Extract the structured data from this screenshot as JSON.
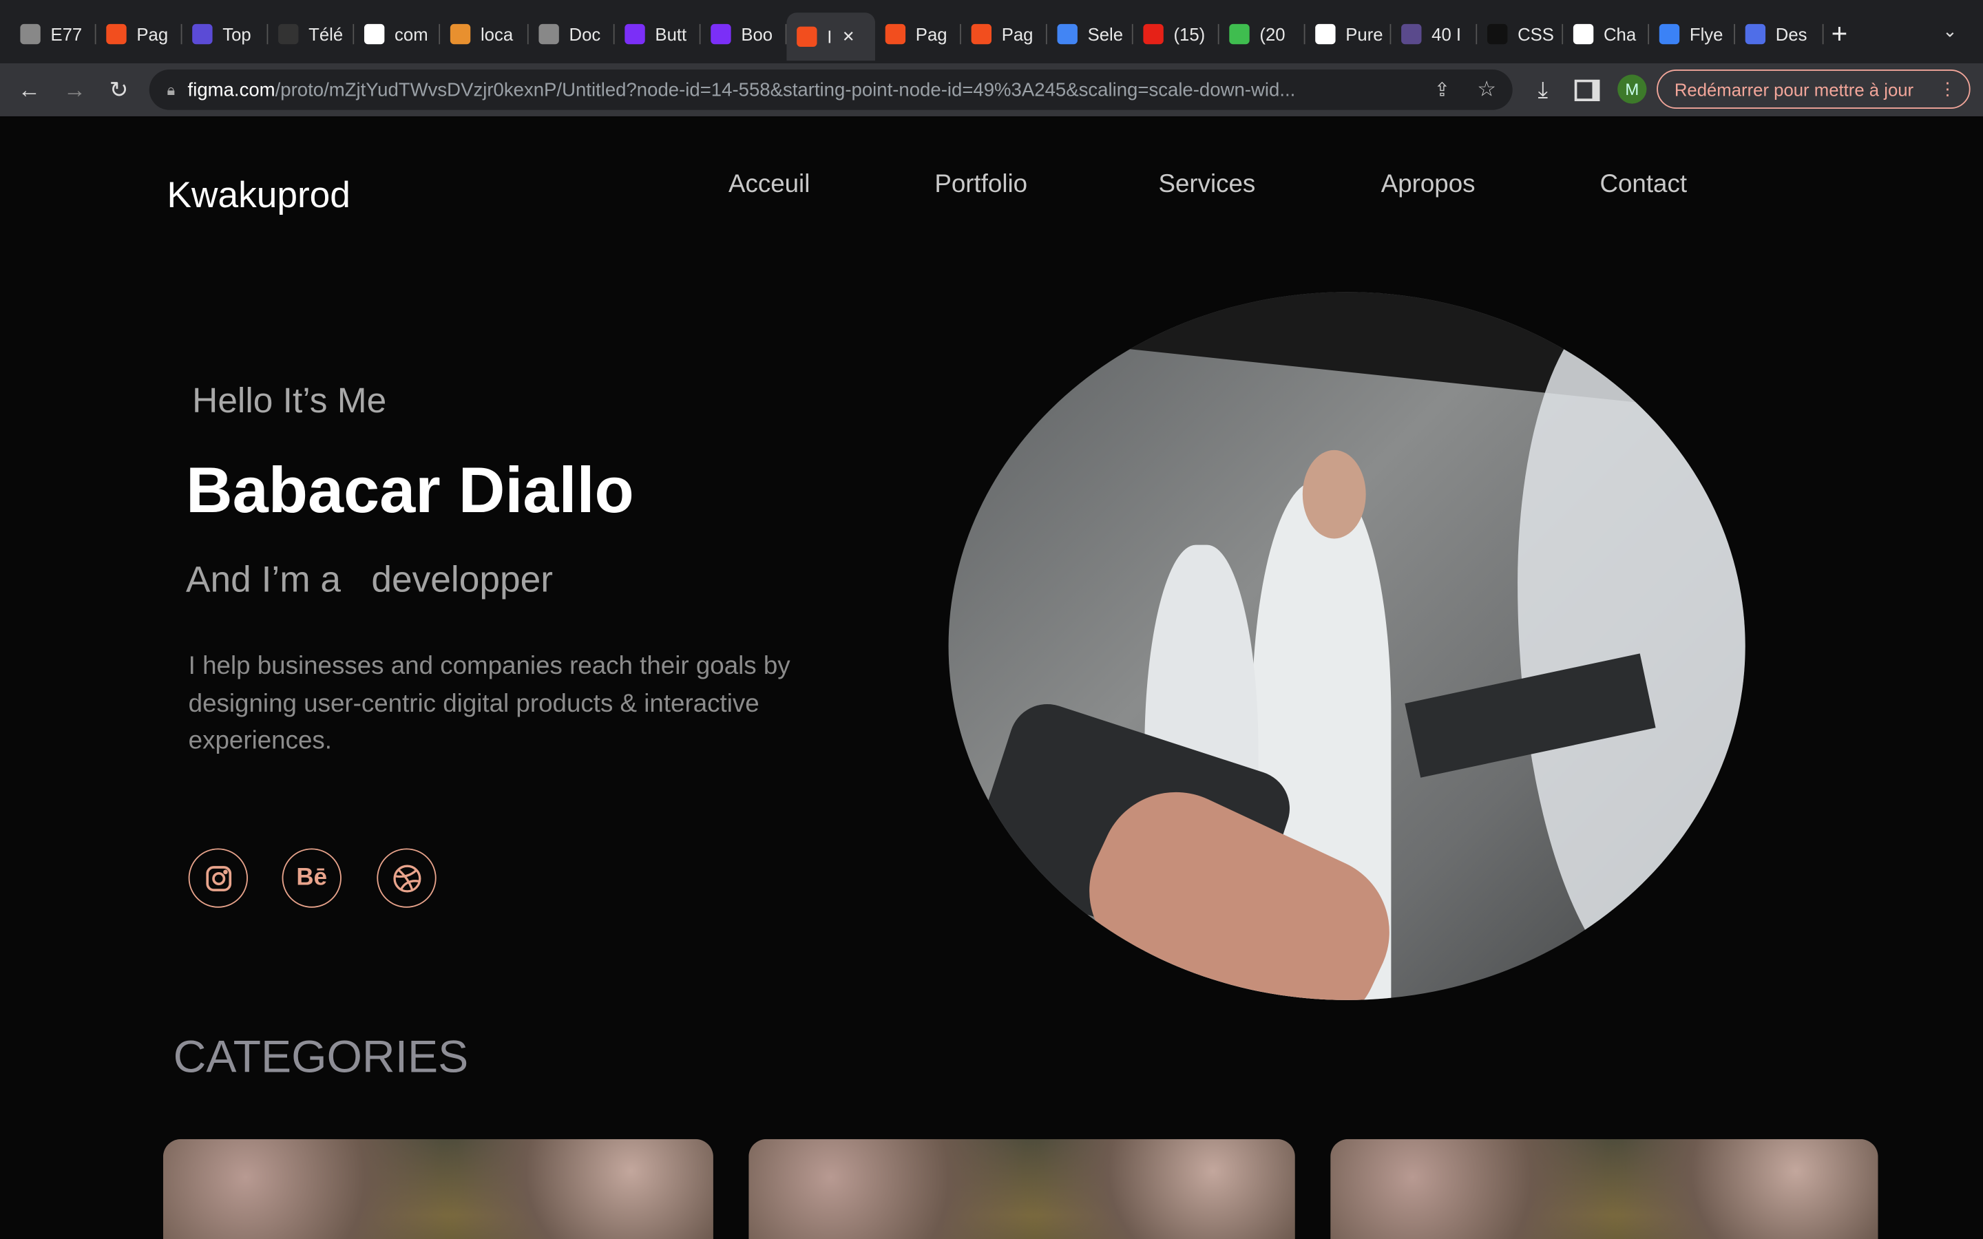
{
  "browser": {
    "tabs": [
      {
        "title": "E77",
        "icon": "globe-icon",
        "color": "#888"
      },
      {
        "title": "Pag",
        "icon": "figma-icon",
        "color": "#f24e1e"
      },
      {
        "title": "Top",
        "icon": "h-logo-icon",
        "color": "#5b4bd6"
      },
      {
        "title": "Télé",
        "icon": "png-icon",
        "color": "#333"
      },
      {
        "title": "com",
        "icon": "google-icon",
        "color": "#fff"
      },
      {
        "title": "loca",
        "icon": "pma-icon",
        "color": "#e8902f"
      },
      {
        "title": "Doc",
        "icon": "globe-icon",
        "color": "#888"
      },
      {
        "title": "Butt",
        "icon": "bootstrap-icon",
        "color": "#7b2ff7"
      },
      {
        "title": "Boo",
        "icon": "bootstrap-icon",
        "color": "#7b2ff7"
      },
      {
        "title": "I",
        "icon": "figma-icon",
        "color": "#f24e1e",
        "active": true
      },
      {
        "title": "Pag",
        "icon": "figma-icon",
        "color": "#f24e1e"
      },
      {
        "title": "Pag",
        "icon": "figma-icon",
        "color": "#f24e1e"
      },
      {
        "title": "Sele",
        "icon": "ads-icon",
        "color": "#4285f4"
      },
      {
        "title": "(15)",
        "icon": "youtube-icon",
        "color": "#e62117"
      },
      {
        "title": "(20",
        "icon": "whatsapp-icon",
        "color": "#3fbd4f"
      },
      {
        "title": "Pure",
        "icon": "pure-icon",
        "color": "#fff"
      },
      {
        "title": "40 I",
        "icon": "colorlib-icon",
        "color": "#5a4a8c"
      },
      {
        "title": "CSS",
        "icon": "m-icon",
        "color": "#111"
      },
      {
        "title": "Cha",
        "icon": "chatgpt-icon",
        "color": "#fff"
      },
      {
        "title": "Flye",
        "icon": "canva-icon",
        "color": "#3b82f6"
      },
      {
        "title": "Des",
        "icon": "desk-icon",
        "color": "#4f6ee8"
      }
    ],
    "url_domain": "figma.com",
    "url_path": "/proto/mZjtYudTWvsDVzjr0kexnP/Untitled?node-id=14-558&starting-point-node-id=49%3A245&scaling=scale-down-wid...",
    "profile_initial": "M",
    "update_label": "Redémarrer pour mettre à jour"
  },
  "site": {
    "logo": "Kwakuprod",
    "nav": [
      "Acceuil",
      "Portfolio",
      "Services",
      "Apropos",
      "Contact"
    ],
    "hello": "Hello It’s Me",
    "name": "Babacar Diallo",
    "role_prefix": "And I’m a",
    "role": "developper",
    "description": "I help businesses and companies reach  their goals by designing user-centric digital  products & interactive experiences.",
    "social": {
      "behance": "Bē"
    },
    "categories_title": "CATEGORIES"
  }
}
